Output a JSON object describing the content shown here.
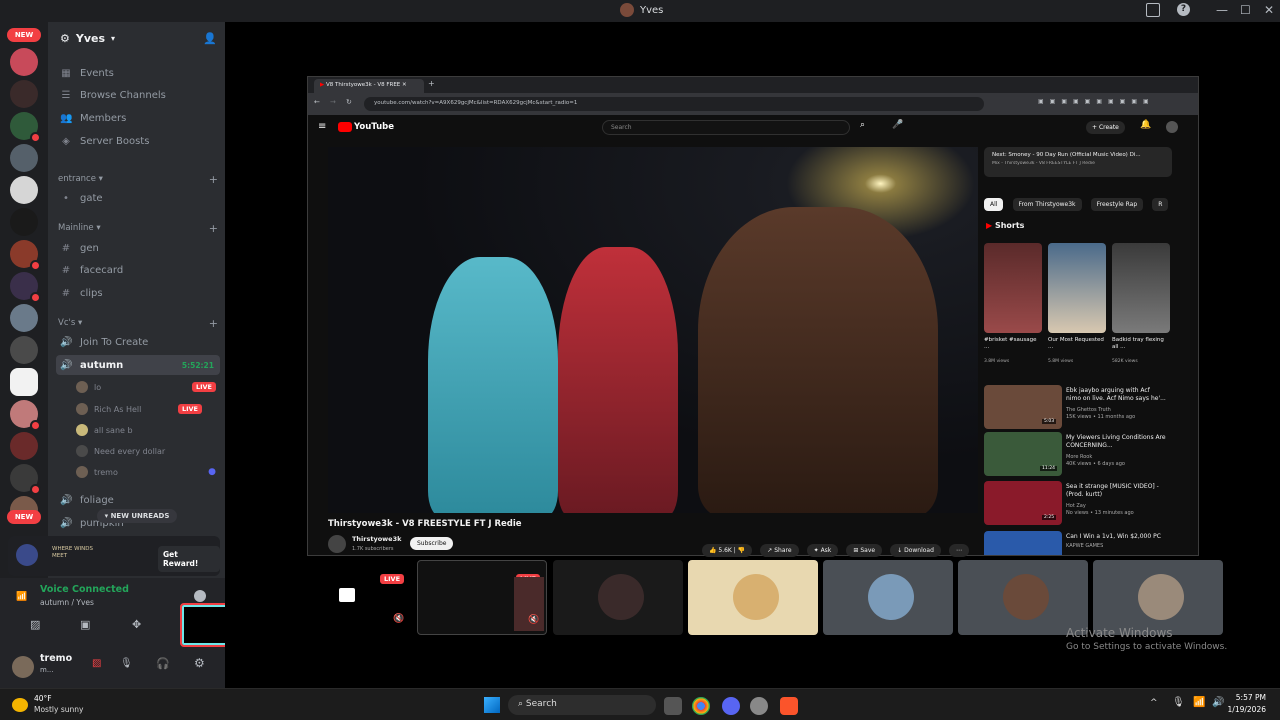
{
  "window": {
    "title": "Yves"
  },
  "guilds": {
    "new_label": "NEW",
    "new_label_2": "NEW"
  },
  "server": {
    "name": "Yves"
  },
  "menu": [
    "Events",
    "Browse Channels",
    "Members",
    "Server Boosts"
  ],
  "categories": {
    "entrance": "entrance",
    "mainline": "Mainline",
    "vcs": "Vc's"
  },
  "channels": {
    "gate": "gate",
    "gen": "gen",
    "facecard": "facecard",
    "clips": "clips",
    "join": "Join To Create",
    "autumn": "autumn",
    "autumn_time": "5:52:21",
    "foliage": "foliage",
    "pumpkin": "pumpkin"
  },
  "voice_users": [
    {
      "name": "lo",
      "live": "LIVE"
    },
    {
      "name": "Rich As Hell",
      "live": "LIVE"
    },
    {
      "name": "all sane b"
    },
    {
      "name": "Need every dollar"
    },
    {
      "name": "tremo"
    }
  ],
  "new_unreads": "NEW UNREADS",
  "promo": {
    "brand": "WHERE WINDS MEET",
    "button": "Get Reward!"
  },
  "voice": {
    "status": "Voice Connected",
    "channel": "autumn / Yves"
  },
  "user": {
    "name": "tremo",
    "sub": "m..."
  },
  "browser": {
    "tab_title": "V8 Thirstyowe3k - V8 FREE",
    "url": "youtube.com/watch?v=A9X629gcjMc&list=RDAX629gcjMc&start_radio=1",
    "yt_logo": "YouTube",
    "search_placeholder": "Search",
    "create": "Create"
  },
  "video": {
    "title": "Thirstyowe3k - V8 FREESTYLE FT J Redie",
    "channel": "Thirstyowe3k",
    "subs": "1.7K subscribers",
    "subscribe": "Subscribe",
    "likes": "5.6K",
    "share": "Share",
    "ask": "Ask",
    "save": "Save",
    "download": "Download"
  },
  "up_next": {
    "title": "Next: Smoney - 90 Day Run (Official Music Video) Di...",
    "sub": "Mix - Thirstyowe3k - V8 FREESTYLE FT J Redie"
  },
  "chips": [
    "All",
    "From Thirstyowe3k",
    "Freestyle Rap",
    "R"
  ],
  "shorts": {
    "label": "Shorts",
    "items": [
      {
        "title": "#brisket #sausage ...",
        "views": "3.8M views"
      },
      {
        "title": "Our Most Requested ...",
        "views": "5.8M views"
      },
      {
        "title": "Badkid tray flexing all ...",
        "views": "582K views"
      }
    ]
  },
  "recommended": [
    {
      "title": "Ebk jaaybo arguing with Acf nimo on live. Acf Nimo says he'...",
      "channel": "The Ghettos Truth",
      "meta": "15K views • 11 months ago",
      "dur": "5:03"
    },
    {
      "title": "My Viewers Living Conditions Are CONCERNING...",
      "channel": "More Rook",
      "meta": "40K views • 6 days ago",
      "dur": "11:24"
    },
    {
      "title": "Sea it strange [MUSIC VIDEO] - (Prod. kurtt)",
      "channel": "Hot Zay",
      "meta": "No views • 13 minutes ago",
      "dur": "2:25"
    },
    {
      "title": "Can I Win a 1v1, Win $2,000 PC",
      "channel": "KAPWE GAMES",
      "meta": "",
      "dur": ""
    }
  ],
  "tiles": {
    "live1": "LIVE",
    "live2": "LIVE"
  },
  "activate": {
    "title": "Activate Windows",
    "sub": "Go to Settings to activate Windows."
  },
  "taskbar": {
    "temp": "40°F",
    "weather": "Mostly sunny",
    "search": "Search",
    "time": "5:57 PM",
    "date": "1/19/2026"
  }
}
